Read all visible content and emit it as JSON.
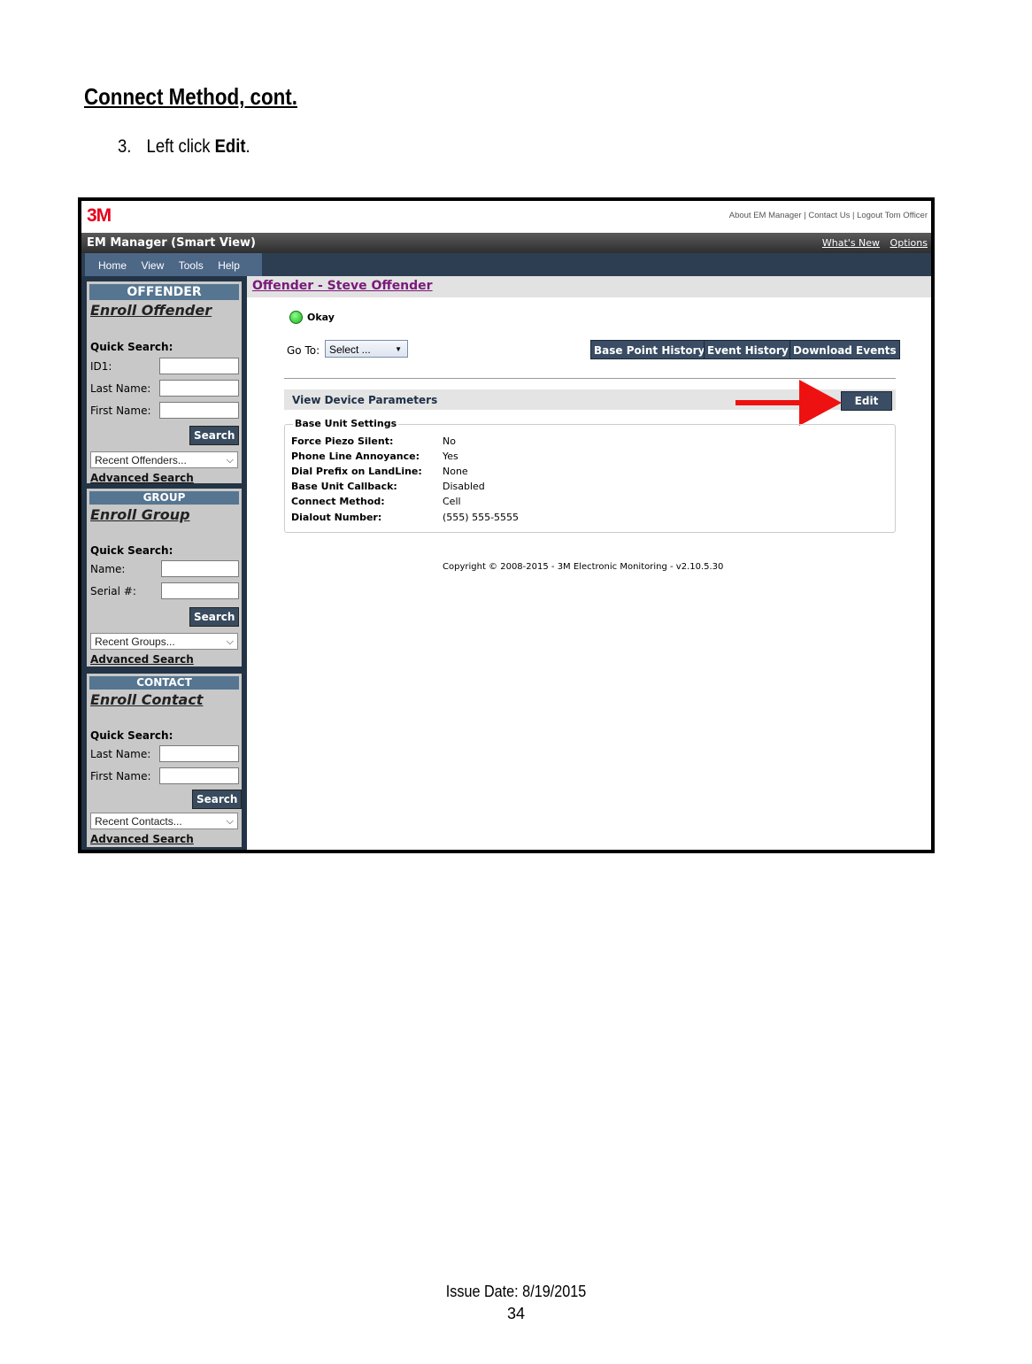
{
  "doc": {
    "title": "Connect Method, cont.",
    "step_number": "3.",
    "step_text_prefix": "Left click ",
    "step_text_bold": "Edit",
    "step_text_suffix": "."
  },
  "app": {
    "logo": "3M",
    "top_links": "About EM Manager | Contact Us | Logout Tom Officer",
    "window_title": "EM Manager (Smart View)",
    "whats_new": "What's New",
    "options": "Options",
    "menu": [
      "Home",
      "View",
      "Tools",
      "Help"
    ]
  },
  "sidebar": {
    "offender": {
      "header": "OFFENDER",
      "enroll": "Enroll Offender",
      "quick_search": "Quick Search:",
      "fields": [
        "ID1:",
        "Last Name:",
        "First Name:"
      ],
      "search": "Search",
      "recent": "Recent Offenders...",
      "advanced": "Advanced Search"
    },
    "group": {
      "header": "GROUP",
      "enroll": "Enroll Group",
      "quick_search": "Quick Search:",
      "fields": [
        "Name:",
        "Serial #:"
      ],
      "search": "Search",
      "recent": "Recent Groups...",
      "advanced": "Advanced Search"
    },
    "contact": {
      "header": "CONTACT",
      "enroll": "Enroll Contact",
      "quick_search": "Quick Search:",
      "fields": [
        "Last Name:",
        "First Name:"
      ],
      "search": "Search",
      "recent": "Recent Contacts...",
      "advanced": "Advanced Search"
    }
  },
  "main": {
    "breadcrumb": "Offender - Steve Offender",
    "status": "Okay",
    "goto_label": "Go To:",
    "goto_select": "Select ...",
    "buttons": [
      "Base Point History",
      "Event History",
      "Download Events"
    ],
    "section_title": "View Device Parameters",
    "edit": "Edit",
    "legend": "Base Unit Settings",
    "params": [
      {
        "label": "Force Piezo Silent:",
        "value": "No"
      },
      {
        "label": "Phone Line Annoyance:",
        "value": "Yes"
      },
      {
        "label": "Dial Prefix on LandLine:",
        "value": "None"
      },
      {
        "label": "Base Unit Callback:",
        "value": "Disabled"
      },
      {
        "label": "Connect Method:",
        "value": "Cell"
      },
      {
        "label": "Dialout Number:",
        "value": "(555) 555-5555"
      }
    ],
    "copyright": "Copyright © 2008-2015 - 3M Electronic Monitoring - v2.10.5.30"
  },
  "footer": {
    "issue_date": "Issue Date: 8/19/2015",
    "page": "34"
  },
  "colors": {
    "annotation_arrow": "#ee1111",
    "logo_red": "#e8001c",
    "nav_dark": "#2d3e52",
    "button_dark": "#3a4d64"
  }
}
